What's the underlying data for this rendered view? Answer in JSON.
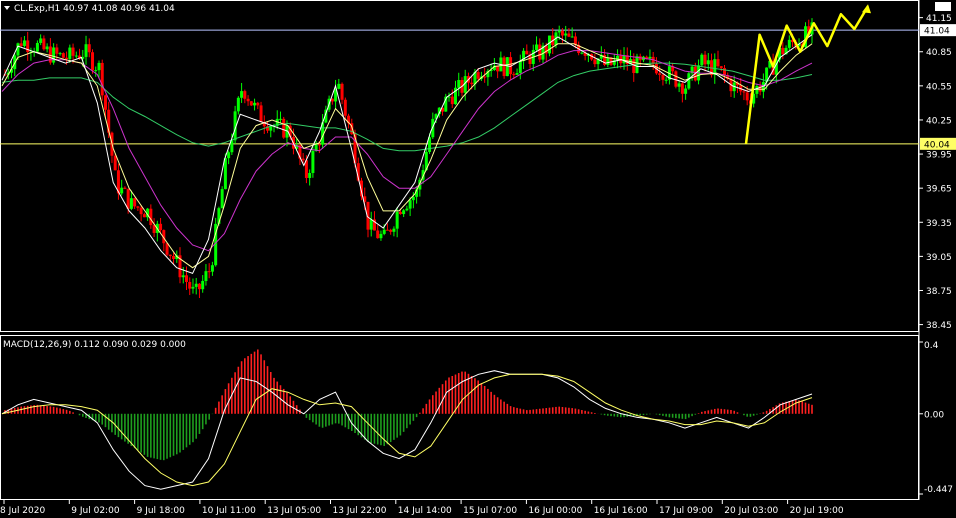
{
  "header": {
    "symbol_line": "CL.Exp,H1  40.97 41.08 40.96 41.04",
    "macd_line": "MACD(12,26,9) 0.112 0.090 0.029 0.000"
  },
  "colors": {
    "background": "#000000",
    "bull": "#00ff00",
    "bear": "#ff0000",
    "ma_fast": "#ffffff",
    "ma_mid": "#ffff99",
    "ma_slow": "#cc33cc",
    "ma_long": "#33cc66",
    "projection": "#ffff00",
    "macd_line": "#ffffff",
    "signal_line": "#ffff66",
    "hist_pos": "#ff2020",
    "hist_neg": "#1e9e1e",
    "level_line": "#ffff66",
    "top_line": "#b8c4ff"
  },
  "chart_data": [
    {
      "type": "candlestick",
      "title": "CL.Exp,H1",
      "ohlc_readout": {
        "open": 40.97,
        "high": 41.08,
        "low": 40.96,
        "close": 41.04
      },
      "y_ticks": [
        41.15,
        40.85,
        40.55,
        40.25,
        39.95,
        39.65,
        39.35,
        39.05,
        38.75,
        38.45
      ],
      "ylim": [
        38.42,
        41.27
      ],
      "x_ticks": [
        "8 Jul 2020",
        "9 Jul 02:00",
        "9 Jul 18:00",
        "10 Jul 11:00",
        "13 Jul 05:00",
        "13 Jul 22:00",
        "14 Jul 14:00",
        "15 Jul 07:00",
        "16 Jul 00:00",
        "16 Jul 16:00",
        "17 Jul 09:00",
        "20 Jul 03:00",
        "20 Jul 19:00"
      ],
      "horizontal_levels": [
        {
          "value": 41.04,
          "label": "41.04"
        },
        {
          "value": 40.04,
          "label": "40.04"
        }
      ],
      "price_path": [
        40.65,
        40.95,
        40.9,
        40.82,
        40.8,
        40.85,
        40.7,
        39.7,
        39.5,
        39.45,
        39.2,
        38.95,
        38.7,
        38.95,
        39.9,
        40.55,
        40.3,
        40.2,
        40.15,
        39.75,
        40.15,
        40.6,
        40.05,
        39.3,
        39.2,
        39.5,
        39.6,
        40.2,
        40.45,
        40.55,
        40.7,
        40.75,
        40.7,
        40.8,
        40.85,
        41.0,
        40.92,
        40.85,
        40.72,
        40.78,
        40.72,
        40.75,
        40.65,
        40.55,
        40.75,
        40.7,
        40.55,
        40.45,
        40.6,
        40.85,
        40.95,
        41.02
      ],
      "series": [
        {
          "name": "ma_fast",
          "values": [
            40.6,
            40.9,
            40.85,
            40.8,
            40.75,
            40.8,
            40.4,
            39.7,
            39.45,
            39.3,
            39.1,
            38.95,
            38.9,
            39.2,
            39.9,
            40.3,
            40.25,
            40.2,
            40.15,
            39.85,
            40.15,
            40.55,
            40.0,
            39.4,
            39.3,
            39.5,
            39.7,
            40.15,
            40.45,
            40.55,
            40.7,
            40.75,
            40.72,
            40.8,
            40.88,
            40.98,
            40.9,
            40.82,
            40.75,
            40.78,
            40.72,
            40.72,
            40.62,
            40.58,
            40.7,
            40.65,
            40.55,
            40.5,
            40.55,
            40.8,
            40.9,
            41.0
          ]
        },
        {
          "name": "ma_mid",
          "values": [
            40.55,
            40.8,
            40.85,
            40.82,
            40.78,
            40.75,
            40.55,
            40.0,
            39.65,
            39.45,
            39.25,
            39.05,
            38.95,
            39.05,
            39.5,
            40.0,
            40.2,
            40.25,
            40.2,
            40.0,
            40.05,
            40.35,
            40.2,
            39.75,
            39.45,
            39.45,
            39.6,
            39.9,
            40.25,
            40.45,
            40.6,
            40.72,
            40.74,
            40.78,
            40.83,
            40.92,
            40.92,
            40.86,
            40.8,
            40.78,
            40.75,
            40.73,
            40.66,
            40.6,
            40.65,
            40.66,
            40.6,
            40.52,
            40.52,
            40.68,
            40.82,
            40.92
          ]
        },
        {
          "name": "ma_slow",
          "values": [
            40.5,
            40.65,
            40.75,
            40.78,
            40.78,
            40.75,
            40.65,
            40.35,
            40.0,
            39.75,
            39.5,
            39.3,
            39.15,
            39.1,
            39.25,
            39.55,
            39.8,
            39.95,
            40.05,
            40.0,
            39.98,
            40.1,
            40.1,
            39.95,
            39.75,
            39.65,
            39.65,
            39.75,
            39.95,
            40.15,
            40.35,
            40.5,
            40.6,
            40.68,
            40.74,
            40.82,
            40.86,
            40.86,
            40.84,
            40.82,
            40.8,
            40.78,
            40.73,
            40.68,
            40.66,
            40.66,
            40.63,
            40.58,
            40.55,
            40.6,
            40.68,
            40.75
          ]
        },
        {
          "name": "ma_long",
          "values": [
            40.58,
            40.6,
            40.6,
            40.62,
            40.62,
            40.62,
            40.58,
            40.45,
            40.35,
            40.28,
            40.2,
            40.12,
            40.05,
            40.02,
            40.05,
            40.1,
            40.15,
            40.2,
            40.22,
            40.2,
            40.18,
            40.18,
            40.15,
            40.08,
            40.0,
            39.98,
            39.98,
            40.0,
            40.02,
            40.05,
            40.1,
            40.18,
            40.28,
            40.38,
            40.48,
            40.58,
            40.64,
            40.68,
            40.7,
            40.72,
            40.74,
            40.75,
            40.75,
            40.74,
            40.72,
            40.7,
            40.68,
            40.64,
            40.6,
            40.6,
            40.62,
            40.65
          ]
        }
      ],
      "projection": [
        40.04,
        41.0,
        40.72,
        41.08,
        40.85,
        41.1,
        40.9,
        41.18,
        41.05,
        41.25
      ]
    },
    {
      "type": "bar",
      "title": "MACD(12,26,9)",
      "readout": {
        "macd": 0.112,
        "signal": 0.09,
        "histogram": 0.029,
        "extra": 0.0
      },
      "y_ticks": [
        0.4,
        0.0,
        -0.447
      ],
      "y_tick_labels": [
        "0.4",
        "0.00",
        "-0.447"
      ],
      "ylim": [
        -0.447,
        0.4
      ],
      "histogram": [
        0.02,
        0.04,
        0.05,
        0.04,
        0.02,
        -0.02,
        -0.05,
        -0.12,
        -0.18,
        -0.24,
        -0.26,
        -0.22,
        -0.15,
        -0.02,
        0.15,
        0.3,
        0.36,
        0.2,
        0.1,
        -0.02,
        -0.08,
        -0.05,
        -0.1,
        -0.16,
        -0.18,
        -0.12,
        -0.02,
        0.1,
        0.2,
        0.24,
        0.18,
        0.1,
        0.04,
        0.02,
        0.03,
        0.04,
        0.03,
        0.01,
        -0.01,
        -0.02,
        -0.01,
        0.0,
        -0.02,
        -0.03,
        0.01,
        0.03,
        0.02,
        -0.02,
        0.01,
        0.06,
        0.08,
        0.05
      ],
      "series": [
        {
          "name": "macd",
          "values": [
            0.0,
            0.05,
            0.08,
            0.06,
            0.04,
            0.02,
            -0.05,
            -0.2,
            -0.32,
            -0.4,
            -0.42,
            -0.4,
            -0.38,
            -0.25,
            0.02,
            0.2,
            0.18,
            0.12,
            0.05,
            0.0,
            0.08,
            0.12,
            -0.05,
            -0.15,
            -0.22,
            -0.25,
            -0.2,
            -0.05,
            0.12,
            0.18,
            0.22,
            0.24,
            0.22,
            0.22,
            0.22,
            0.2,
            0.15,
            0.08,
            0.03,
            0.0,
            -0.02,
            -0.03,
            -0.05,
            -0.08,
            -0.05,
            -0.02,
            -0.05,
            -0.08,
            -0.02,
            0.05,
            0.08,
            0.11
          ]
        },
        {
          "name": "signal",
          "values": [
            0.0,
            0.02,
            0.04,
            0.05,
            0.05,
            0.04,
            0.02,
            -0.05,
            -0.15,
            -0.25,
            -0.33,
            -0.38,
            -0.4,
            -0.38,
            -0.28,
            -0.1,
            0.08,
            0.14,
            0.12,
            0.08,
            0.05,
            0.06,
            0.04,
            -0.05,
            -0.14,
            -0.22,
            -0.24,
            -0.18,
            -0.05,
            0.08,
            0.16,
            0.2,
            0.22,
            0.22,
            0.22,
            0.21,
            0.18,
            0.12,
            0.06,
            0.02,
            -0.01,
            -0.03,
            -0.04,
            -0.06,
            -0.06,
            -0.04,
            -0.05,
            -0.07,
            -0.05,
            0.01,
            0.06,
            0.09
          ]
        }
      ]
    }
  ]
}
